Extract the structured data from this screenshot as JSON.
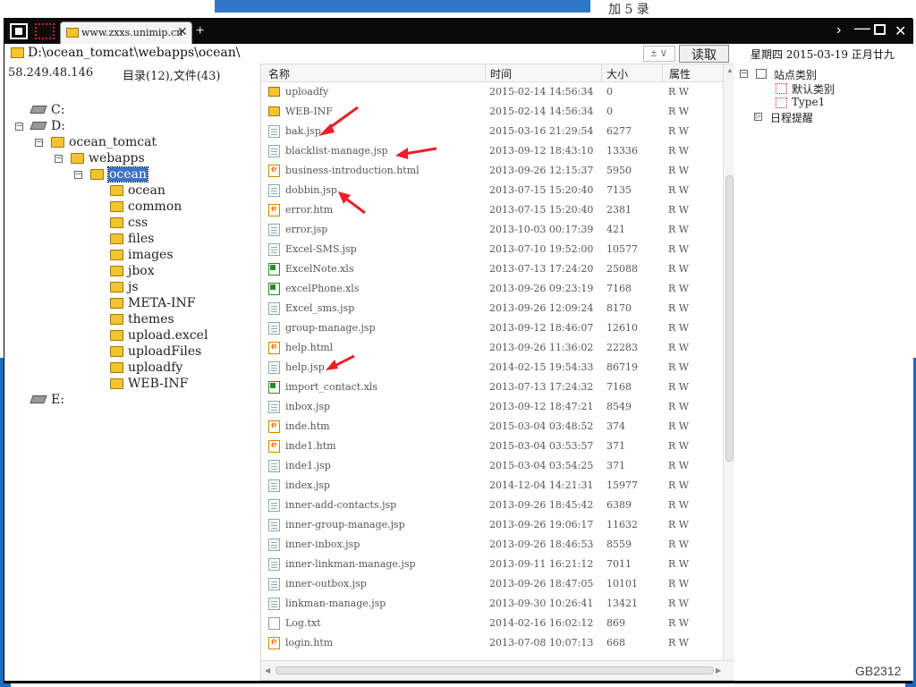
{
  "background": {
    "top_text": "加 5 录"
  },
  "window": {
    "tab_label": "www.zxxs.unimip.cn",
    "tab_close": "✕",
    "new_tab": "+",
    "ctl_next": "›",
    "ctl_min": "—",
    "ctl_close": "✕"
  },
  "address": {
    "path": "D:\\ocean_tomcat\\webapps\\ocean\\",
    "dropdown": "± ∨",
    "read_button": "读取",
    "date": "星期四 2015-03-19 正月廿九"
  },
  "info": {
    "ip": "58.249.48.146",
    "count": "目录(12),文件(43)"
  },
  "tree": [
    {
      "label": "C:",
      "type": "drive",
      "depth": 0,
      "expander": ""
    },
    {
      "label": "D:",
      "type": "drive",
      "depth": 0,
      "expander": "−"
    },
    {
      "label": "ocean_tomcat",
      "type": "folder",
      "depth": 1,
      "expander": "−"
    },
    {
      "label": "webapps",
      "type": "folder",
      "depth": 2,
      "expander": "−"
    },
    {
      "label": "ocean",
      "type": "folder",
      "depth": 3,
      "expander": "−",
      "selected": true
    },
    {
      "label": "ocean",
      "type": "folder",
      "depth": 4,
      "expander": ""
    },
    {
      "label": "common",
      "type": "folder",
      "depth": 4,
      "expander": ""
    },
    {
      "label": "css",
      "type": "folder",
      "depth": 4,
      "expander": ""
    },
    {
      "label": "files",
      "type": "folder",
      "depth": 4,
      "expander": ""
    },
    {
      "label": "images",
      "type": "folder",
      "depth": 4,
      "expander": ""
    },
    {
      "label": "jbox",
      "type": "folder",
      "depth": 4,
      "expander": ""
    },
    {
      "label": "js",
      "type": "folder",
      "depth": 4,
      "expander": ""
    },
    {
      "label": "META-INF",
      "type": "folder",
      "depth": 4,
      "expander": ""
    },
    {
      "label": "themes",
      "type": "folder",
      "depth": 4,
      "expander": ""
    },
    {
      "label": "upload.excel",
      "type": "folder",
      "depth": 4,
      "expander": ""
    },
    {
      "label": "uploadFiles",
      "type": "folder",
      "depth": 4,
      "expander": ""
    },
    {
      "label": "uploadfy",
      "type": "folder",
      "depth": 4,
      "expander": ""
    },
    {
      "label": "WEB-INF",
      "type": "folder",
      "depth": 4,
      "expander": ""
    },
    {
      "label": "E:",
      "type": "drive",
      "depth": 0,
      "expander": ""
    }
  ],
  "columns": {
    "name": "名称",
    "time": "时间",
    "size": "大小",
    "attr": "属性"
  },
  "files": [
    {
      "name": "uploadfy",
      "time": "2015-02-14 14:56:34",
      "size": "0",
      "attr": "R W",
      "icon": "folder"
    },
    {
      "name": "WEB-INF",
      "time": "2015-02-14 14:56:34",
      "size": "0",
      "attr": "R W",
      "icon": "folder"
    },
    {
      "name": "bak.jsp",
      "time": "2015-03-16 21:29:54",
      "size": "6277",
      "attr": "R W",
      "icon": "jsp"
    },
    {
      "name": "blacklist-manage.jsp",
      "time": "2013-09-12 18:43:10",
      "size": "13336",
      "attr": "R W",
      "icon": "jsp"
    },
    {
      "name": "business-introduction.html",
      "time": "2013-09-26 12:15:37",
      "size": "5950",
      "attr": "R W",
      "icon": "html"
    },
    {
      "name": "dobbin.jsp",
      "time": "2013-07-15 15:20:40",
      "size": "7135",
      "attr": "R W",
      "icon": "jsp"
    },
    {
      "name": "error.htm",
      "time": "2013-07-15 15:20:40",
      "size": "2381",
      "attr": "R W",
      "icon": "html"
    },
    {
      "name": "error.jsp",
      "time": "2013-10-03 00:17:39",
      "size": "421",
      "attr": "R W",
      "icon": "jsp"
    },
    {
      "name": "Excel-SMS.jsp",
      "time": "2013-07-10 19:52:00",
      "size": "10577",
      "attr": "R W",
      "icon": "jsp"
    },
    {
      "name": "ExcelNote.xls",
      "time": "2013-07-13 17:24:20",
      "size": "25088",
      "attr": "R W",
      "icon": "xls"
    },
    {
      "name": "excelPhone.xls",
      "time": "2013-09-26 09:23:19",
      "size": "7168",
      "attr": "R W",
      "icon": "xls"
    },
    {
      "name": "Excel_sms.jsp",
      "time": "2013-09-26 12:09:24",
      "size": "8170",
      "attr": "R W",
      "icon": "jsp"
    },
    {
      "name": "group-manage.jsp",
      "time": "2013-09-12 18:46:07",
      "size": "12610",
      "attr": "R W",
      "icon": "jsp"
    },
    {
      "name": "help.html",
      "time": "2013-09-26 11:36:02",
      "size": "22283",
      "attr": "R W",
      "icon": "html"
    },
    {
      "name": "help.jsp",
      "time": "2014-02-15 19:54:33",
      "size": "86719",
      "attr": "R W",
      "icon": "jsp"
    },
    {
      "name": "import_contact.xls",
      "time": "2013-07-13 17:24:32",
      "size": "7168",
      "attr": "R W",
      "icon": "xls"
    },
    {
      "name": "inbox.jsp",
      "time": "2013-09-12 18:47:21",
      "size": "8549",
      "attr": "R W",
      "icon": "jsp"
    },
    {
      "name": "inde.htm",
      "time": "2015-03-04 03:48:52",
      "size": "374",
      "attr": "R W",
      "icon": "html"
    },
    {
      "name": "inde1.htm",
      "time": "2015-03-04 03:53:57",
      "size": "371",
      "attr": "R W",
      "icon": "html"
    },
    {
      "name": "inde1.jsp",
      "time": "2015-03-04 03:54:25",
      "size": "371",
      "attr": "R W",
      "icon": "jsp"
    },
    {
      "name": "index.jsp",
      "time": "2014-12-04 14:21:31",
      "size": "15977",
      "attr": "R W",
      "icon": "jsp"
    },
    {
      "name": "inner-add-contacts.jsp",
      "time": "2013-09-26 18:45:42",
      "size": "6389",
      "attr": "R W",
      "icon": "jsp"
    },
    {
      "name": "inner-group-manage.jsp",
      "time": "2013-09-26 19:06:17",
      "size": "11632",
      "attr": "R W",
      "icon": "jsp"
    },
    {
      "name": "inner-inbox.jsp",
      "time": "2013-09-26 18:46:53",
      "size": "8559",
      "attr": "R W",
      "icon": "jsp"
    },
    {
      "name": "inner-linkman-manage.jsp",
      "time": "2013-09-11 16:21:12",
      "size": "7011",
      "attr": "R W",
      "icon": "jsp"
    },
    {
      "name": "inner-outbox.jsp",
      "time": "2013-09-26 18:47:05",
      "size": "10101",
      "attr": "R W",
      "icon": "jsp"
    },
    {
      "name": "linkman-manage.jsp",
      "time": "2013-09-30 10:26:41",
      "size": "13421",
      "attr": "R W",
      "icon": "jsp"
    },
    {
      "name": "Log.txt",
      "time": "2014-02-16 16:02:12",
      "size": "869",
      "attr": "R W",
      "icon": "txt"
    },
    {
      "name": "login.htm",
      "time": "2013-07-08 10:07:13",
      "size": "668",
      "attr": "R W",
      "icon": "html"
    }
  ],
  "right_panel": {
    "site_category": "站点类别",
    "default_category": "默认类别",
    "type1": "Type1",
    "schedule": "日程提醒",
    "expander_minus": "−",
    "expander_plus": "▷"
  },
  "watermark": "GB2312",
  "colors": {
    "selection": "#3a72c8",
    "arrow": "#e8202a",
    "titlebar": "#0a0a0a"
  }
}
